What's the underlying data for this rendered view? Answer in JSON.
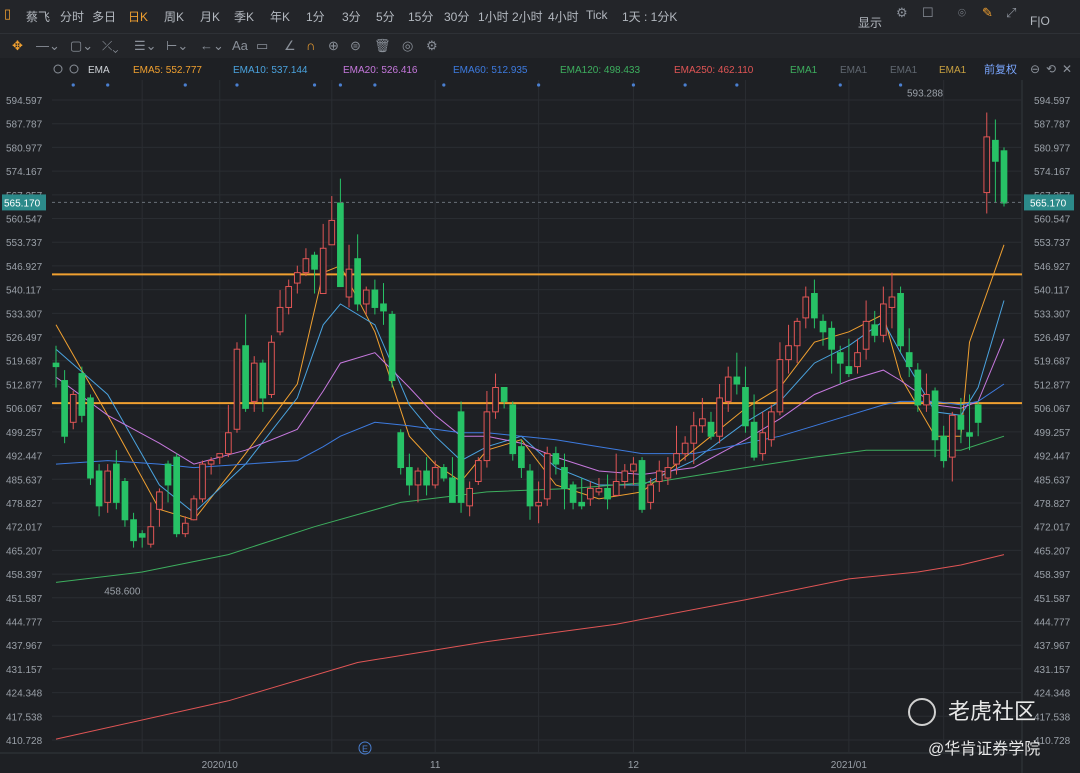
{
  "toolbar": {
    "tabs": [
      "蔡飞",
      "分时",
      "多日",
      "日K",
      "周K",
      "月K",
      "季K",
      "年K",
      "1分",
      "3分",
      "5分",
      "15分",
      "30分",
      "1小时",
      "2小时",
      "4小时",
      "Tick",
      "1天 : 1分K"
    ],
    "active_tab": "日K",
    "display_label": "显示",
    "fio_label": "F|O",
    "icons": [
      "sidebar-icon",
      "settings-icon",
      "layout-icon",
      "camera-icon",
      "pencil-icon",
      "fullscreen-icon"
    ]
  },
  "drawing_tools": [
    "move-icon",
    "line-icon",
    "rect-icon",
    "fib-icon",
    "grid-icon",
    "measure-icon",
    "arrow-icon",
    "text-icon",
    "comment-icon",
    "eraser-icon",
    "magnet-icon",
    "link-icon",
    "lock-icon",
    "trash-icon",
    "eye-icon",
    "gear-icon"
  ],
  "indicators": {
    "name": "EMA",
    "items": [
      {
        "label": "EMA5: 552.777",
        "color": "#f0a030"
      },
      {
        "label": "EMA10: 537.144",
        "color": "#4aa3df"
      },
      {
        "label": "EMA20: 526.416",
        "color": "#c678dd"
      },
      {
        "label": "EMA60: 512.935",
        "color": "#3d7be0"
      },
      {
        "label": "EMA120: 498.433",
        "color": "#3dae5e"
      },
      {
        "label": "EMA250: 462.110",
        "color": "#e05555"
      },
      {
        "label": "EMA1",
        "color": "#3dae5e"
      },
      {
        "label": "EMA1",
        "color": "#606770"
      },
      {
        "label": "EMA1",
        "color": "#606770"
      },
      {
        "label": "EMA1",
        "color": "#c8a040"
      }
    ],
    "adjust_label": "前复权"
  },
  "watermark": {
    "brand": "老虎社区",
    "sub": "@华肯证券学院"
  },
  "chart_data": {
    "type": "candlestick",
    "y_ticks": [
      "594.597",
      "587.787",
      "580.977",
      "574.167",
      "567.357",
      "560.547",
      "553.737",
      "546.927",
      "540.117",
      "533.307",
      "526.497",
      "519.687",
      "512.877",
      "506.067",
      "499.257",
      "492.447",
      "485.637",
      "478.827",
      "472.017",
      "465.207",
      "458.397",
      "451.587",
      "444.777",
      "437.967",
      "431.157",
      "424.348",
      "417.538",
      "410.728"
    ],
    "ylim": [
      410.728,
      594.597
    ],
    "x_labels": [
      "2020/10",
      "11",
      "12",
      "2021/01"
    ],
    "last_price": "565.170",
    "high_label": "593.288",
    "low_label": "458.600",
    "horizontal_lines": [
      544.5,
      507.5
    ],
    "candles": [
      [
        519,
        518,
        524,
        512
      ],
      [
        514,
        498,
        517,
        496
      ],
      [
        502,
        510,
        511,
        500
      ],
      [
        516,
        504,
        518,
        502
      ],
      [
        509,
        486,
        510,
        484
      ],
      [
        488,
        478,
        490,
        475
      ],
      [
        479,
        488,
        490,
        476
      ],
      [
        490,
        479,
        494,
        477
      ],
      [
        485,
        474,
        486,
        472
      ],
      [
        474,
        468,
        476,
        466
      ],
      [
        470,
        469,
        471,
        466
      ],
      [
        467,
        472,
        479,
        466
      ],
      [
        477,
        482,
        483,
        472
      ],
      [
        490,
        484,
        491,
        479
      ],
      [
        492,
        470,
        493,
        469
      ],
      [
        470,
        473,
        475,
        469
      ],
      [
        474,
        480,
        481,
        474
      ],
      [
        480,
        490,
        491,
        479
      ],
      [
        490,
        491,
        492,
        487
      ],
      [
        492,
        493,
        493,
        490
      ],
      [
        493,
        499,
        507,
        492
      ],
      [
        500,
        523,
        525,
        499
      ],
      [
        524,
        506,
        533,
        505
      ],
      [
        508,
        519,
        521,
        505
      ],
      [
        519,
        509,
        520,
        505
      ],
      [
        510,
        525,
        527,
        509
      ],
      [
        528,
        535,
        540,
        527
      ],
      [
        535,
        541,
        543,
        533
      ],
      [
        542,
        545,
        547,
        539
      ],
      [
        545,
        549,
        552,
        544
      ],
      [
        550,
        546,
        551,
        539
      ],
      [
        539,
        552,
        559,
        540
      ],
      [
        553,
        560,
        567,
        553
      ],
      [
        565,
        541,
        572,
        541
      ],
      [
        538,
        546,
        553,
        535
      ],
      [
        549,
        536,
        556,
        534
      ],
      [
        536,
        540,
        541,
        533
      ],
      [
        540,
        535,
        543,
        533
      ],
      [
        536,
        534,
        542,
        530
      ],
      [
        533,
        514,
        534,
        512
      ],
      [
        499,
        489,
        500,
        487
      ],
      [
        489,
        484,
        493,
        481
      ],
      [
        484,
        488,
        489,
        479
      ],
      [
        488,
        484,
        492,
        481
      ],
      [
        484,
        489,
        491,
        483
      ],
      [
        489,
        486,
        490,
        485
      ],
      [
        486,
        479,
        492,
        479
      ],
      [
        505,
        479,
        508,
        476
      ],
      [
        478,
        483,
        485,
        475
      ],
      [
        485,
        491,
        492,
        484
      ],
      [
        491,
        505,
        511,
        489
      ],
      [
        505,
        512,
        516,
        503
      ],
      [
        512,
        508,
        512,
        506
      ],
      [
        507,
        493,
        508,
        491
      ],
      [
        495,
        489,
        497,
        486
      ],
      [
        488,
        478,
        490,
        474
      ],
      [
        478,
        479,
        485,
        473
      ],
      [
        480,
        493,
        495,
        478
      ],
      [
        493,
        490,
        495,
        487
      ],
      [
        489,
        483,
        493,
        477
      ],
      [
        484,
        479,
        485,
        477
      ],
      [
        479,
        478,
        486,
        477
      ],
      [
        480,
        483,
        485,
        478
      ],
      [
        482,
        483,
        486,
        481
      ],
      [
        483,
        480,
        487,
        477
      ],
      [
        481,
        485,
        493,
        481
      ],
      [
        485,
        488,
        490,
        483
      ],
      [
        488,
        490,
        492,
        484
      ],
      [
        491,
        477,
        492,
        476
      ],
      [
        479,
        484,
        486,
        477
      ],
      [
        485,
        488,
        491,
        482
      ],
      [
        486,
        489,
        492,
        484
      ],
      [
        490,
        493,
        501,
        487
      ],
      [
        493,
        496,
        498,
        491
      ],
      [
        496,
        501,
        505,
        490
      ],
      [
        501,
        503,
        509,
        499
      ],
      [
        502,
        498,
        505,
        497
      ],
      [
        498,
        509,
        513,
        496
      ],
      [
        508,
        515,
        518,
        505
      ],
      [
        515,
        513,
        522,
        510
      ],
      [
        512,
        501,
        518,
        499
      ],
      [
        502,
        492,
        510,
        491
      ],
      [
        493,
        499,
        505,
        491
      ],
      [
        497,
        505,
        507,
        495
      ],
      [
        505,
        520,
        525,
        504
      ],
      [
        520,
        524,
        530,
        516
      ],
      [
        524,
        531,
        532,
        519
      ],
      [
        532,
        538,
        541,
        529
      ],
      [
        539,
        532,
        543,
        529
      ],
      [
        531,
        528,
        533,
        524
      ],
      [
        529,
        523,
        531,
        516
      ],
      [
        522,
        519,
        524,
        513
      ],
      [
        518,
        516,
        526,
        515
      ],
      [
        518,
        522,
        526,
        516
      ],
      [
        523,
        531,
        537,
        520
      ],
      [
        530,
        527,
        534,
        525
      ],
      [
        527,
        536,
        541,
        525
      ],
      [
        535,
        538,
        545,
        529
      ],
      [
        539,
        524,
        541,
        522
      ],
      [
        522,
        518,
        529,
        515
      ],
      [
        517,
        507,
        519,
        505
      ],
      [
        507,
        510,
        516,
        505
      ],
      [
        511,
        497,
        512,
        492
      ],
      [
        498,
        491,
        501,
        489
      ],
      [
        492,
        504,
        505,
        485
      ],
      [
        504,
        500,
        509,
        496
      ],
      [
        499,
        498,
        510,
        494
      ],
      [
        507,
        502,
        508,
        498
      ],
      [
        568,
        584,
        591,
        562
      ],
      [
        583,
        577,
        589,
        565
      ],
      [
        580,
        565,
        581,
        564
      ]
    ],
    "series": [
      {
        "name": "EMA5",
        "values": [
          [
            0,
            530
          ],
          [
            6,
            504
          ],
          [
            12,
            477
          ],
          [
            16,
            474
          ],
          [
            22,
            493
          ],
          [
            28,
            513
          ],
          [
            31,
            545
          ],
          [
            33,
            547
          ],
          [
            37,
            528
          ],
          [
            41,
            498
          ],
          [
            44,
            490
          ],
          [
            47,
            485
          ],
          [
            50,
            494
          ],
          [
            54,
            497
          ],
          [
            58,
            484
          ],
          [
            63,
            480
          ],
          [
            68,
            482
          ],
          [
            74,
            494
          ],
          [
            80,
            506
          ],
          [
            84,
            512
          ],
          [
            88,
            525
          ],
          [
            92,
            528
          ],
          [
            96,
            533
          ],
          [
            98,
            515
          ],
          [
            102,
            498
          ],
          [
            105,
            498
          ],
          [
            106,
            525
          ],
          [
            110,
            553
          ]
        ]
      },
      {
        "name": "EMA10",
        "values": [
          [
            0,
            523
          ],
          [
            6,
            510
          ],
          [
            12,
            484
          ],
          [
            16,
            476
          ],
          [
            22,
            490
          ],
          [
            28,
            509
          ],
          [
            31,
            530
          ],
          [
            33,
            536
          ],
          [
            37,
            530
          ],
          [
            41,
            507
          ],
          [
            44,
            498
          ],
          [
            47,
            491
          ],
          [
            50,
            495
          ],
          [
            54,
            498
          ],
          [
            58,
            489
          ],
          [
            63,
            484
          ],
          [
            68,
            484
          ],
          [
            74,
            491
          ],
          [
            80,
            502
          ],
          [
            84,
            508
          ],
          [
            88,
            519
          ],
          [
            92,
            524
          ],
          [
            96,
            531
          ],
          [
            98,
            522
          ],
          [
            102,
            505
          ],
          [
            105,
            504
          ],
          [
            107,
            512
          ],
          [
            110,
            537
          ]
        ]
      },
      {
        "name": "EMA20",
        "values": [
          [
            0,
            515
          ],
          [
            6,
            504
          ],
          [
            12,
            496
          ],
          [
            16,
            490
          ],
          [
            22,
            494
          ],
          [
            28,
            500
          ],
          [
            31,
            511
          ],
          [
            33,
            519
          ],
          [
            37,
            522
          ],
          [
            41,
            512
          ],
          [
            44,
            504
          ],
          [
            47,
            498
          ],
          [
            50,
            498
          ],
          [
            54,
            496
          ],
          [
            58,
            492
          ],
          [
            63,
            488
          ],
          [
            68,
            487
          ],
          [
            74,
            489
          ],
          [
            80,
            497
          ],
          [
            84,
            503
          ],
          [
            88,
            510
          ],
          [
            92,
            514
          ],
          [
            96,
            517
          ],
          [
            98,
            514
          ],
          [
            102,
            507
          ],
          [
            105,
            506
          ],
          [
            107,
            508
          ],
          [
            110,
            526
          ]
        ]
      },
      {
        "name": "EMA60",
        "values": [
          [
            0,
            490
          ],
          [
            6,
            491
          ],
          [
            12,
            490
          ],
          [
            16,
            489
          ],
          [
            22,
            490
          ],
          [
            28,
            491
          ],
          [
            31,
            495
          ],
          [
            33,
            498
          ],
          [
            37,
            502
          ],
          [
            41,
            501
          ],
          [
            44,
            500
          ],
          [
            47,
            499
          ],
          [
            50,
            499
          ],
          [
            54,
            498
          ],
          [
            58,
            497
          ],
          [
            63,
            495
          ],
          [
            68,
            493
          ],
          [
            74,
            493
          ],
          [
            80,
            496
          ],
          [
            84,
            498
          ],
          [
            88,
            501
          ],
          [
            92,
            504
          ],
          [
            96,
            507
          ],
          [
            98,
            508
          ],
          [
            102,
            508
          ],
          [
            105,
            507
          ],
          [
            107,
            508
          ],
          [
            110,
            513
          ]
        ]
      },
      {
        "name": "EMA120",
        "values": [
          [
            0,
            456
          ],
          [
            10,
            459
          ],
          [
            20,
            464
          ],
          [
            30,
            472
          ],
          [
            40,
            479
          ],
          [
            50,
            482
          ],
          [
            60,
            483
          ],
          [
            70,
            485
          ],
          [
            80,
            489
          ],
          [
            88,
            492
          ],
          [
            94,
            494
          ],
          [
            100,
            494
          ],
          [
            105,
            494
          ],
          [
            110,
            498
          ]
        ]
      },
      {
        "name": "EMA250",
        "values": [
          [
            0,
            411
          ],
          [
            20,
            422
          ],
          [
            35,
            433
          ],
          [
            50,
            439
          ],
          [
            65,
            444
          ],
          [
            80,
            451
          ],
          [
            92,
            457
          ],
          [
            100,
            459
          ],
          [
            105,
            461
          ],
          [
            110,
            464
          ]
        ]
      }
    ]
  }
}
